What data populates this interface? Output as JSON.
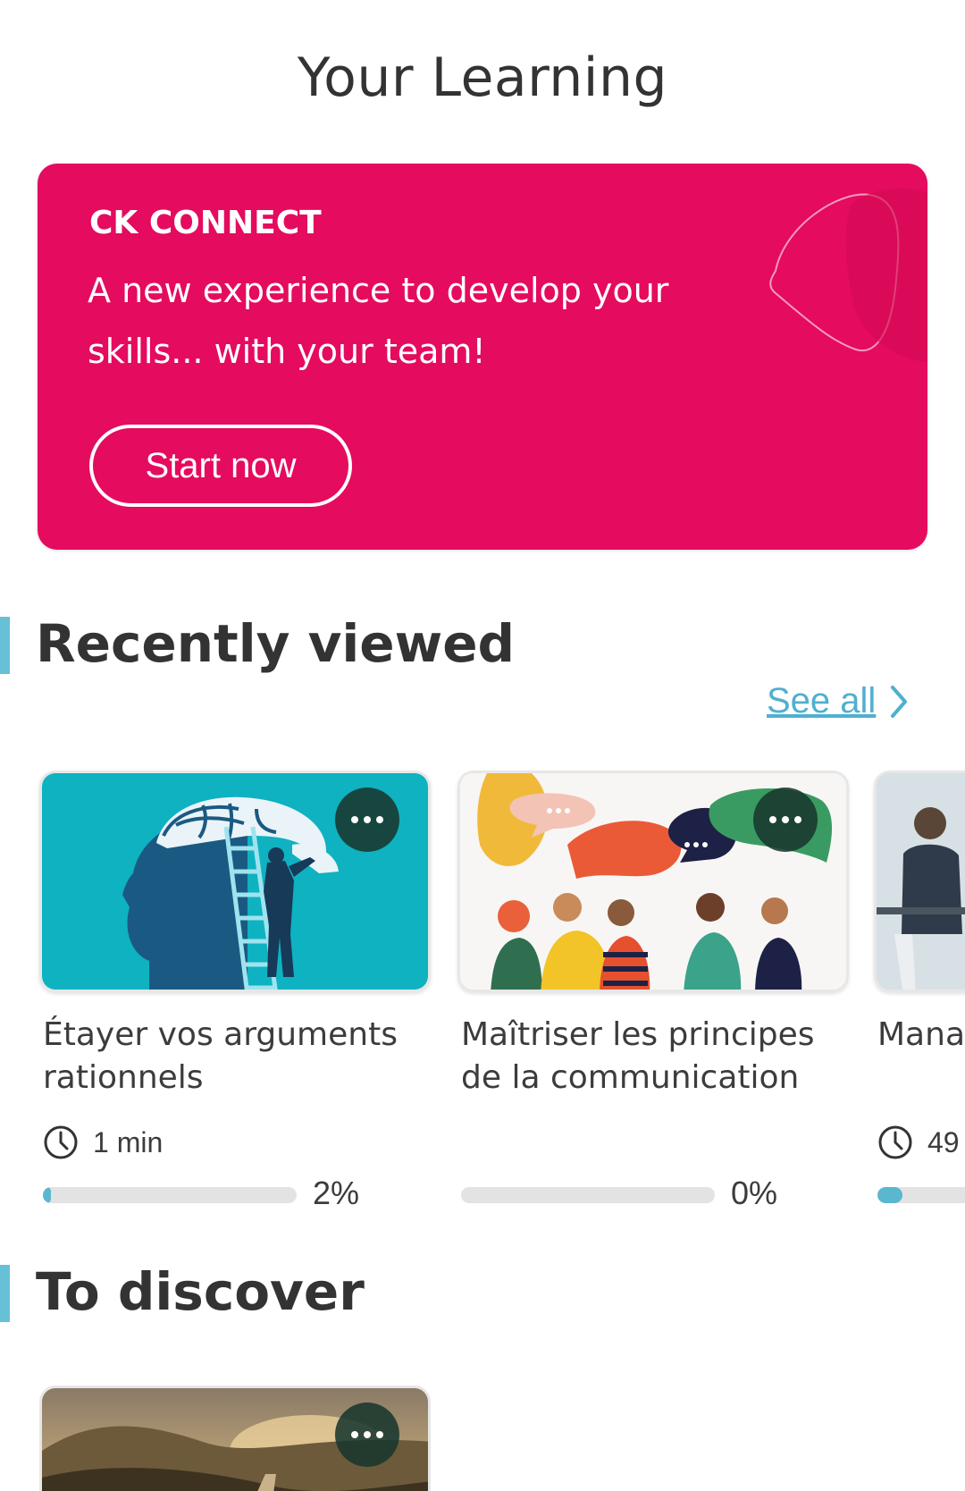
{
  "header": {
    "title": "Your Learning"
  },
  "promo": {
    "eyebrow": "CK CONNECT",
    "description": "A new experience to develop your skills... with your team!",
    "cta_label": "Start now",
    "color": "#e50b5f"
  },
  "recently_viewed": {
    "title": "Recently viewed",
    "see_all_label": "See all",
    "accent_color": "#66c0d6",
    "cards": [
      {
        "title": "Étayer vos arguments rationnels",
        "duration": "1 min",
        "progress_label": "2%",
        "progress": 0.02
      },
      {
        "title": "Maîtriser les principes de la communication",
        "duration": "",
        "progress_label": "0%",
        "progress": 0.0
      },
      {
        "title": "Manager d'emp",
        "duration": "49",
        "progress_label": "",
        "progress": 0.1
      }
    ]
  },
  "to_discover": {
    "title": "To discover"
  },
  "icons": {
    "more": "more-dots-icon",
    "clock": "clock-icon",
    "chevron": "chevron-right-icon"
  }
}
